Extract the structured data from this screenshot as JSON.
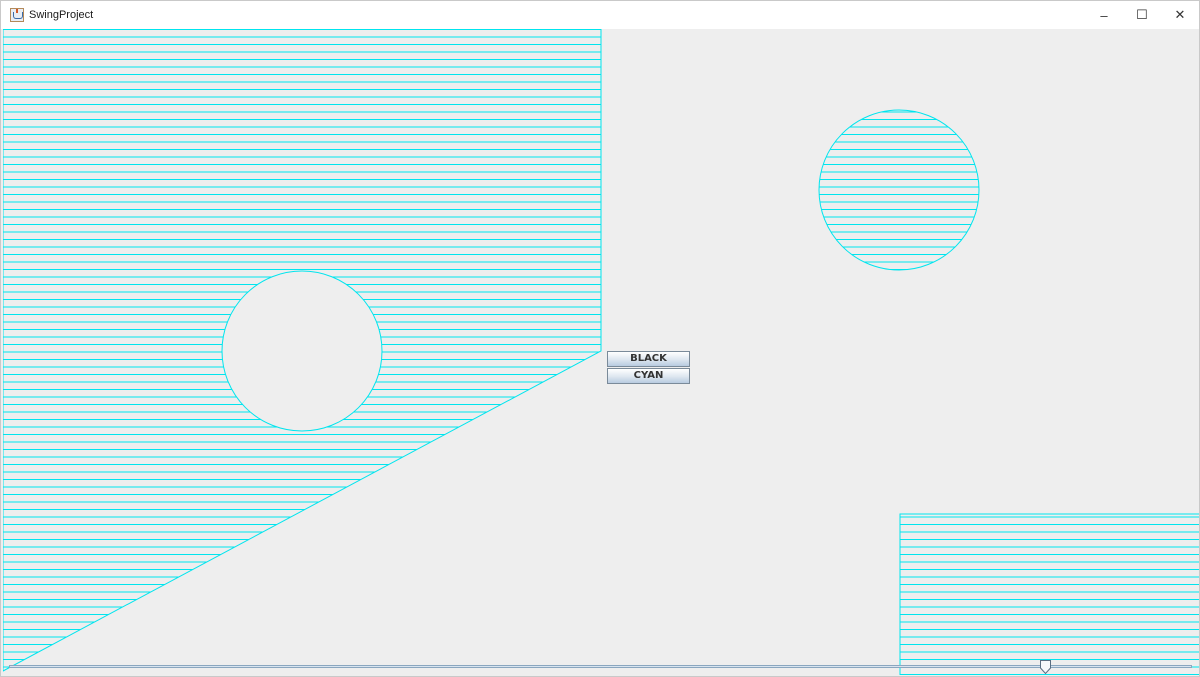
{
  "window": {
    "title": "SwingProject",
    "controls": {
      "minimize": "–",
      "maximize": "☐",
      "close": "✕"
    }
  },
  "buttons": {
    "black_label": "BLACK",
    "cyan_label": "CYAN"
  },
  "slider": {
    "value_fraction": 0.88
  },
  "colors": {
    "hatch": "#00e5ee",
    "background": "#eeeeee",
    "titlebar": "#ffffff"
  },
  "icons": {
    "app": "java-cup-icon"
  }
}
